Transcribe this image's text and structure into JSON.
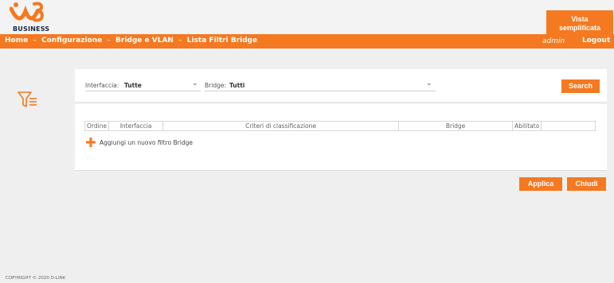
{
  "brand": {
    "logo_text": "BUSINESS",
    "accent_color": "#f47920"
  },
  "header": {
    "vista_button_line1": "Vista",
    "vista_button_line2": "semplificata"
  },
  "nav": {
    "breadcrumb": [
      "Home",
      "Configurazione",
      "Bridge e VLAN",
      "Lista Filtri Bridge"
    ],
    "breadcrumb_separator": "–",
    "user": "admin",
    "logout_label": "Logout"
  },
  "filter": {
    "icon": "filter-icon",
    "interfaccia_label": "Interfaccia:",
    "interfaccia_value": "Tutte",
    "bridge_label": "Bridge:",
    "bridge_value": "Tutti",
    "search_label": "Search"
  },
  "table": {
    "columns": [
      "Ordine",
      "Interfaccia",
      "Criteri di classificazione",
      "Bridge",
      "Abilitato",
      ""
    ]
  },
  "add_filter_label": "Aggiungi un nuovo filtro Bridge",
  "actions": {
    "applica_label": "Applica",
    "chiudi_label": "Chiudi"
  },
  "footer": {
    "copyright": "COPYRIGHT © 2020 D-LINK"
  }
}
